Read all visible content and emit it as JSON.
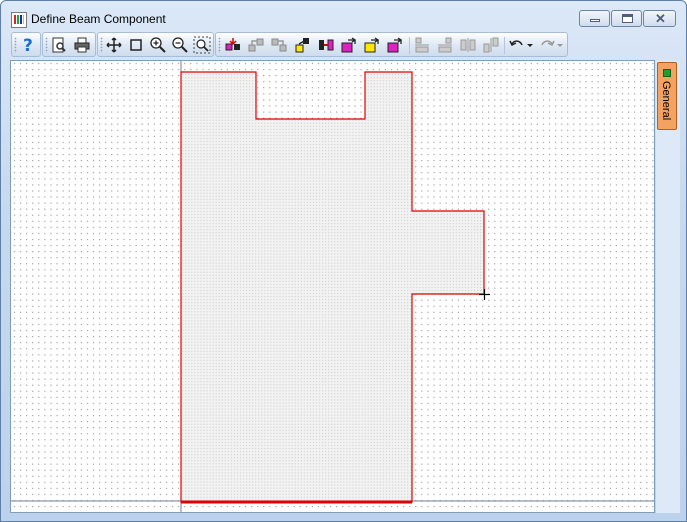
{
  "window": {
    "title": "Define Beam Component"
  },
  "title_bar": {
    "minimize_icon": "minimize-icon",
    "maximize_icon": "maximize-icon",
    "close_icon": "close-icon"
  },
  "toolbar": {
    "groups": [
      {
        "name": "help",
        "buttons": [
          "help-icon"
        ]
      },
      {
        "name": "file",
        "buttons": [
          "print-preview-icon",
          "print-icon"
        ]
      },
      {
        "name": "view",
        "buttons": [
          "pan-icon",
          "zoom-window-icon",
          "zoom-in-icon",
          "zoom-out-icon",
          "zoom-extents-icon"
        ]
      },
      {
        "name": "edit",
        "buttons": [
          "insert-point-before-icon",
          "insert-point-icon",
          "insert-point-after-icon",
          "move-point-icon",
          "mirror-points-icon",
          "insert-shape-magenta-icon",
          "insert-shape-yellow-icon",
          "insert-shape-magenta-yellow-icon",
          "align-left-icon",
          "align-right-icon",
          "distribute-h-icon",
          "distribute-v-icon",
          "undo-icon",
          "undo-dropdown-icon",
          "redo-icon",
          "redo-dropdown-icon"
        ]
      }
    ]
  },
  "side_tabs": [
    {
      "label": "General",
      "active": true
    }
  ],
  "colors": {
    "outline": "#e00000",
    "section_fill": "#f2f2f2",
    "grid_dot": "#7a7a7a",
    "tab_background": "#f4a261",
    "tab_square": "#1f9e2c"
  },
  "cursor_icon": "crosshair-icon"
}
